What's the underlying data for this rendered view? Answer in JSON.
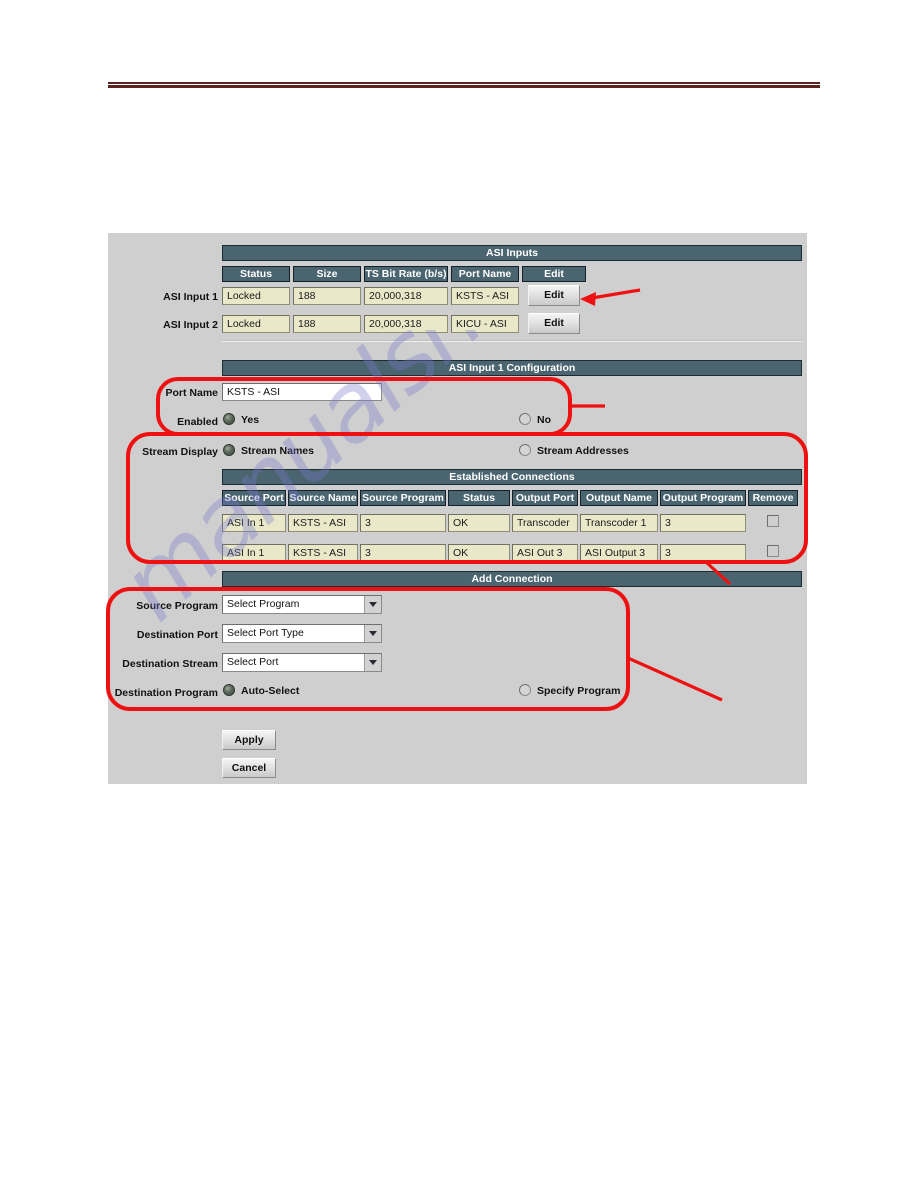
{
  "colors": {
    "panel_bg": "#cfcfcf",
    "header_bar": "#4a6570",
    "field_khaki": "#e9e8c9",
    "annotation_red": "#ee1111",
    "rule_maroon": "#5b2222",
    "watermark": "#7878cd"
  },
  "watermark": {
    "text": "manualshive.com"
  },
  "asi_inputs": {
    "title": "ASI Inputs",
    "columns": [
      "Status",
      "Size",
      "TS Bit Rate (b/s)",
      "Port Name",
      "Edit"
    ],
    "rows": [
      {
        "label": "ASI Input 1",
        "status": "Locked",
        "size": "188",
        "bitrate": "20,000,318",
        "port_name": "KSTS - ASI",
        "edit_label": "Edit"
      },
      {
        "label": "ASI Input 2",
        "status": "Locked",
        "size": "188",
        "bitrate": "20,000,318",
        "port_name": "KICU - ASI",
        "edit_label": "Edit"
      }
    ]
  },
  "input_config": {
    "title": "ASI Input 1 Configuration",
    "port_name_label": "Port Name",
    "port_name_value": "KSTS - ASI",
    "enabled_label": "Enabled",
    "enabled_options": [
      {
        "label": "Yes",
        "selected": true
      },
      {
        "label": "No",
        "selected": false
      }
    ]
  },
  "stream_display": {
    "label": "Stream Display",
    "options": [
      {
        "label": "Stream Names",
        "selected": true
      },
      {
        "label": "Stream Addresses",
        "selected": false
      }
    ]
  },
  "established_connections": {
    "title": "Established Connections",
    "columns": [
      "Source Port",
      "Source Name",
      "Source Program",
      "Status",
      "Output Port",
      "Output Name",
      "Output Program",
      "Remove"
    ],
    "rows": [
      {
        "source_port": "ASI In 1",
        "source_name": "KSTS - ASI",
        "source_program": "3",
        "status": "OK",
        "output_port": "Transcoder",
        "output_name": "Transcoder 1",
        "output_program": "3",
        "remove_checked": false
      },
      {
        "source_port": "ASI In 1",
        "source_name": "KSTS - ASI",
        "source_program": "3",
        "status": "OK",
        "output_port": "ASI Out 3",
        "output_name": "ASI Output 3",
        "output_program": "3",
        "remove_checked": false
      }
    ]
  },
  "add_connection": {
    "title": "Add Connection",
    "fields": [
      {
        "label": "Source Program",
        "value": "Select Program"
      },
      {
        "label": "Destination Port",
        "value": "Select Port Type"
      },
      {
        "label": "Destination Stream",
        "value": "Select Port"
      }
    ],
    "destination_program_label": "Destination Program",
    "destination_program_options": [
      {
        "label": "Auto-Select",
        "selected": true
      },
      {
        "label": "Specify Program",
        "selected": false
      }
    ]
  },
  "form_buttons": {
    "apply": "Apply",
    "cancel": "Cancel"
  }
}
